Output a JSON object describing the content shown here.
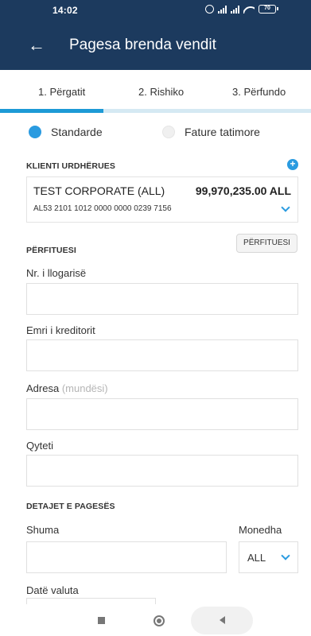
{
  "status_bar": {
    "time": "14:02",
    "battery": "70"
  },
  "app_bar": {
    "title": "Pagesa brenda vendit",
    "back_icon": "arrow-left-icon"
  },
  "steps": [
    {
      "label": "1. Përgatit"
    },
    {
      "label": "2. Rishiko"
    },
    {
      "label": "3. Përfundo"
    }
  ],
  "progress": {
    "current_step": 1,
    "total_steps": 3
  },
  "payment_type": {
    "options": [
      {
        "label": "Standarde",
        "selected": true
      },
      {
        "label": "Fature tatimore",
        "selected": false
      }
    ]
  },
  "ordering_client": {
    "section_label": "KLIENTI URDHËRUES",
    "name": "TEST CORPORATE (ALL)",
    "amount": "99,970,235.00 ALL",
    "iban": "AL53 2101 1012 0000 0000 0239 7156"
  },
  "beneficiary": {
    "section_label": "PËRFITUESI",
    "button_label": "PËRFITUESI",
    "account_label": "Nr. i llogarisë",
    "account_value": "",
    "creditor_label": "Emri i kreditorit",
    "creditor_value": "",
    "address_label": "Adresa",
    "address_optional": "(mundësi)",
    "address_value": "",
    "city_label": "Qyteti",
    "city_value": ""
  },
  "payment_details": {
    "section_label": "DETAJET E PAGESËS",
    "amount_label": "Shuma",
    "amount_value": "",
    "currency_label": "Monedha",
    "currency_value": "ALL",
    "date_label": "Datë valuta"
  },
  "colors": {
    "primary": "#1c3a5e",
    "accent": "#2a9be0"
  }
}
